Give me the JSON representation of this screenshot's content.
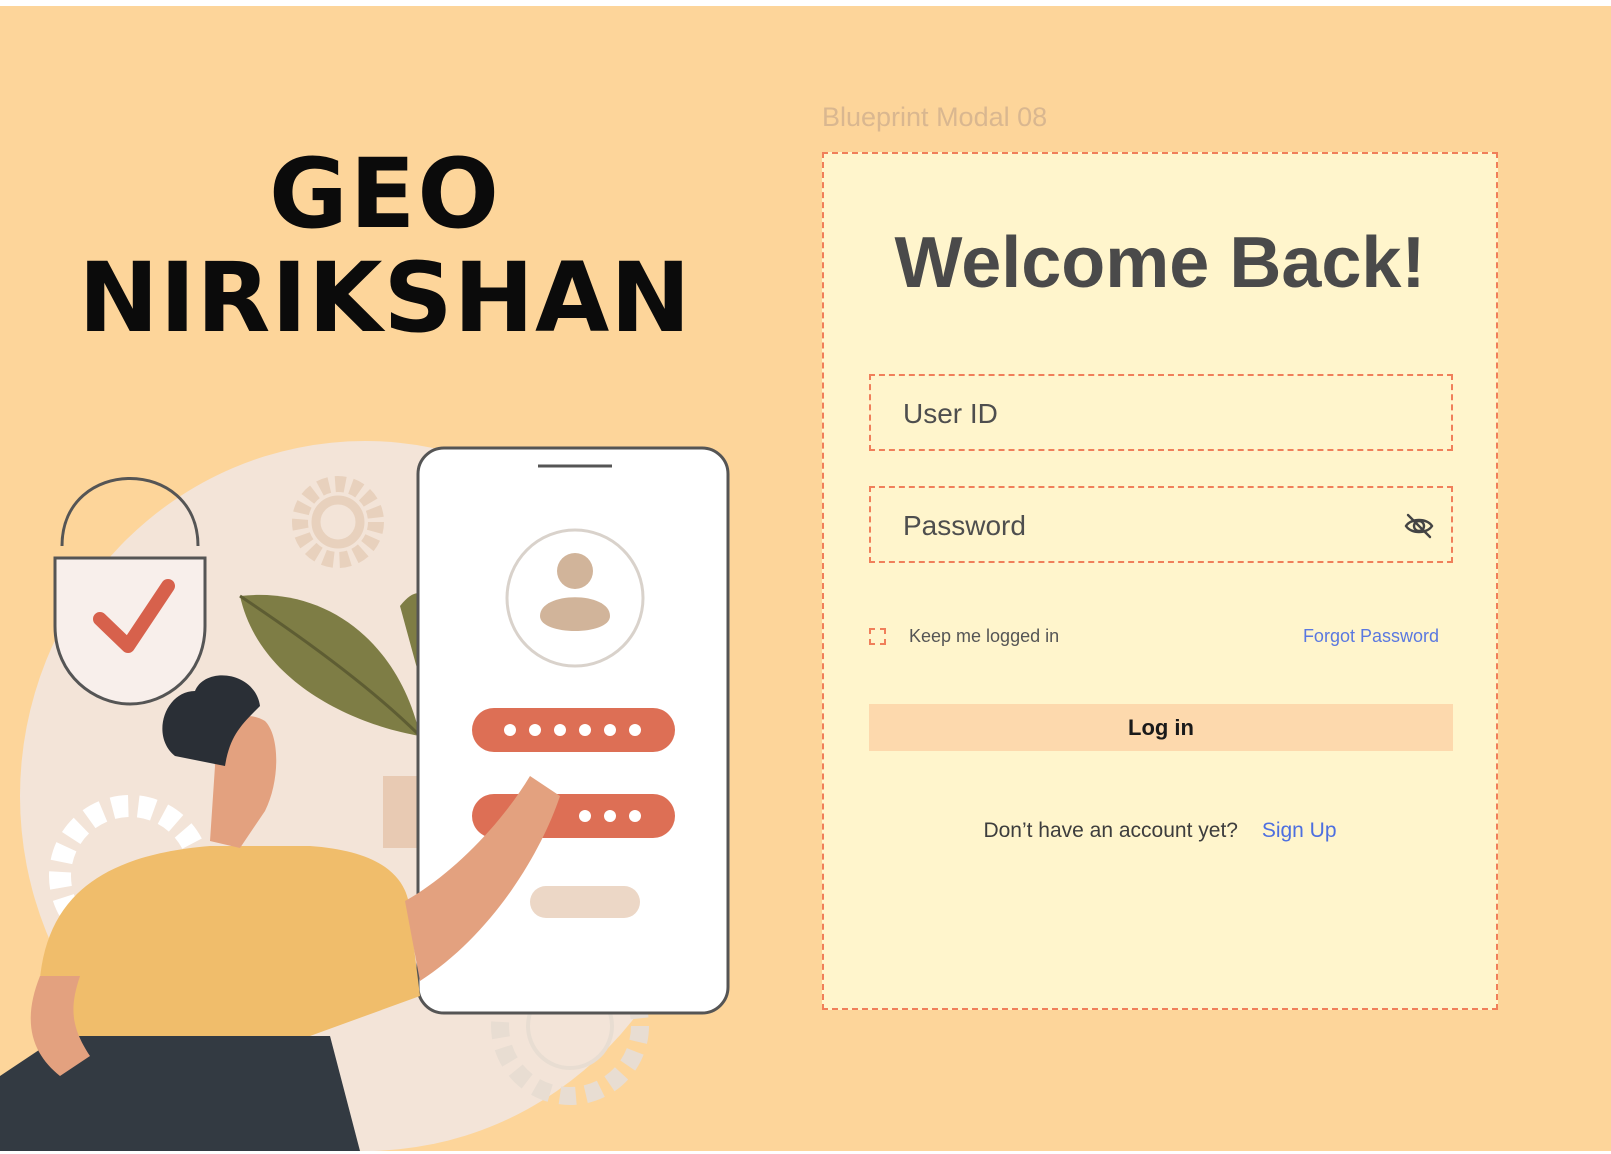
{
  "brand": {
    "line1": "GEO",
    "line2": "NIRIKSHAN"
  },
  "frame_label": "Blueprint Modal 08",
  "modal": {
    "title": "Welcome Back!",
    "user_id_placeholder": "User ID",
    "password_placeholder": "Password",
    "keep_logged_in": "Keep me logged in",
    "forgot_password": "Forgot Password",
    "login_button": "Log in",
    "no_account": "Don’t have an account yet?",
    "sign_up": "Sign Up"
  },
  "icons": {
    "password_toggle": "eye-off-icon",
    "checkbox": "checkbox-icon"
  },
  "colors": {
    "background": "#fdd59a",
    "modal_bg": "#fff5cc",
    "dashed_border": "#f07f5a",
    "login_button_bg": "#fdd9ad",
    "link": "#4d6fe0"
  }
}
